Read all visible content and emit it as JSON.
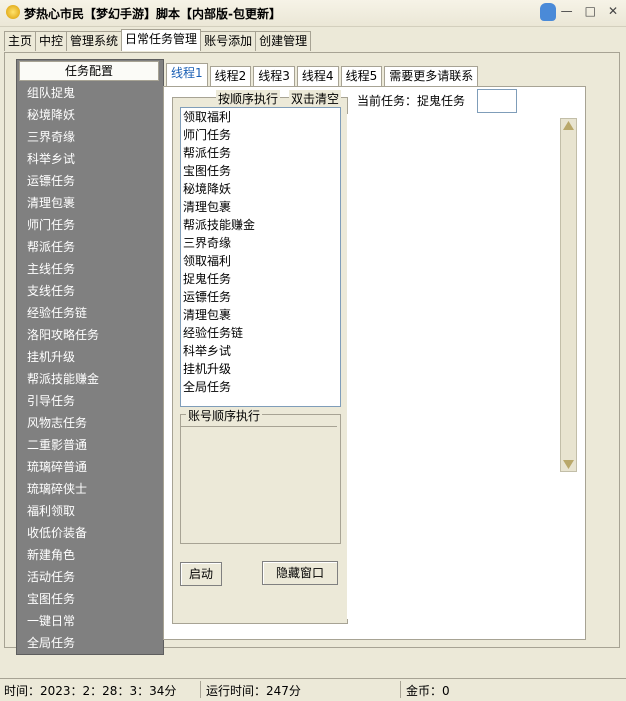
{
  "window": {
    "title": "梦热心市民【梦幻手游】脚本【内部版-包更新】",
    "controls": [
      "—",
      "□",
      "✕"
    ]
  },
  "main_tabs": [
    "主页",
    "中控",
    "管理系统",
    "日常任务管理",
    "账号添加",
    "创建管理"
  ],
  "left_panel": {
    "header": "任务配置",
    "items": [
      "组队捉鬼",
      "秘境降妖",
      "三界奇缘",
      "科举乡试",
      "运镖任务",
      "清理包裹",
      "师门任务",
      "帮派任务",
      "主线任务",
      "支线任务",
      "经验任务链",
      "洛阳攻略任务",
      "挂机升级",
      "帮派技能赚金",
      "引导任务",
      "风物志任务",
      "二重影普通",
      "琉璃碎普通",
      "琉璃碎侠士",
      "福利领取",
      "收低价装备",
      "新建角色",
      "活动任务",
      "宝图任务",
      "一键日常",
      "全局任务"
    ]
  },
  "sub_tabs": [
    "线程1",
    "线程2",
    "线程3",
    "线程4",
    "线程5",
    "需要更多请联系"
  ],
  "group": {
    "title": "按顺序执行",
    "title_right": "双击清空"
  },
  "task_list": [
    "领取福利",
    "师门任务",
    "帮派任务",
    "宝图任务",
    "秘境降妖",
    "清理包裹",
    "帮派技能赚金",
    "三界奇缘",
    "领取福利",
    "捉鬼任务",
    "运镖任务",
    "清理包裹",
    "经验任务链",
    "科举乡试",
    "挂机升级",
    "全局任务"
  ],
  "account_group": {
    "title": "账号顺序执行"
  },
  "buttons": {
    "start": "启动",
    "hide": "隐藏窗口"
  },
  "current_task": {
    "label": "当前任务：捉鬼任务",
    "value": ""
  },
  "status": {
    "time": "时间：2023：2：28：3：34分",
    "runtime": "运行时间：247分",
    "gold": "金币：0"
  }
}
